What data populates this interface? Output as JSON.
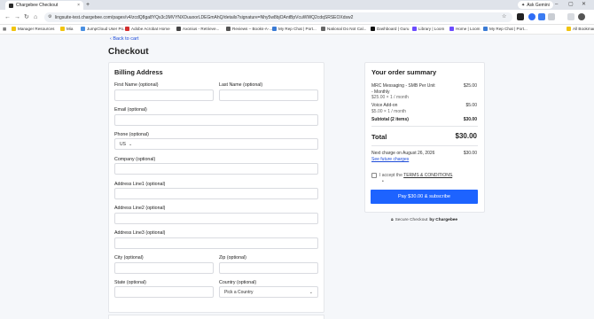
{
  "browser": {
    "tab_title": "Chargebee Checkout",
    "tab_close": "×",
    "new_tab": "+",
    "ask_gemini": "Ask Gemini",
    "url": "lingsuite-test.chargebee.com/pages/v4/zcdQ8ga8YQs3c3MVYNXDuuoorLDEGmAhQ/details?signature=Nhy5w8bjOAntBpVcuWWQ2cdqSRSEOXdsw2",
    "bookmarks": [
      {
        "label": "Manager Resources",
        "icon": "folder-icon"
      },
      {
        "label": "Mia",
        "icon": "folder-icon"
      },
      {
        "label": "JumpCloud User Po...",
        "icon": "cloud-icon"
      },
      {
        "label": "Adobe Acrobat Home",
        "icon": "acrobat-icon"
      },
      {
        "label": "Axonius - Retrieve...",
        "icon": "axonius-icon"
      },
      {
        "label": "Reviews – Books-A-...",
        "icon": "page-icon"
      },
      {
        "label": "My Rep Chat | Port...",
        "icon": "chat-icon"
      },
      {
        "label": "National Do Not Cal...",
        "icon": "phone-icon"
      },
      {
        "label": "Dashboard | Guru",
        "icon": "guru-icon"
      },
      {
        "label": "Library | Loom",
        "icon": "loom-icon"
      },
      {
        "label": "Home | Loom",
        "icon": "loom-icon"
      },
      {
        "label": "My Rep Chat | Port...",
        "icon": "chat-icon"
      },
      {
        "label": "All Bookmarks",
        "icon": "folder-icon"
      }
    ]
  },
  "page": {
    "back_link": "‹ Back to cart",
    "title": "Checkout"
  },
  "billing": {
    "title": "Billing Address",
    "first_name_label": "First Name (optional)",
    "last_name_label": "Last Name (optional)",
    "email_label": "Email (optional)",
    "phone_label": "Phone (optional)",
    "phone_country": "US",
    "company_label": "Company (optional)",
    "address1_label": "Address Line1 (optional)",
    "address2_label": "Address Line2 (optional)",
    "address3_label": "Address Line3 (optional)",
    "city_label": "City (optional)",
    "zip_label": "Zip (optional)",
    "state_label": "State (optional)",
    "country_label": "Country (optional)",
    "country_value": "Pick a Country"
  },
  "summary": {
    "title": "Your order summary",
    "items": [
      {
        "name": "MRC Messaging - SMB Per Unit",
        "name2": "- Monthly",
        "detail": "$25.00 × 1 / month",
        "amount": "$25.00"
      },
      {
        "name": "Voice Add-on",
        "detail": "$5.00 × 1 / month",
        "amount": "$5.00"
      }
    ],
    "subtotal_label": "Subtotal (2 items)",
    "subtotal_amount": "$30.00",
    "total_label": "Total",
    "total_amount": "$30.00",
    "next_charge_label": "Next charge on August 26, 2026",
    "next_charge_amount": "$30.00",
    "future_charges_link": "See future charges",
    "accept_prefix": "I accept the ",
    "terms_link": "TERMS & CONDITIONS",
    "accept_suffix": ".",
    "pay_button": "Pay $30.00 & subscribe",
    "secure_prefix": "Secure Checkout",
    "secure_by": "by Chargebee"
  },
  "colors": {
    "accent": "#1d63ff",
    "link": "#1c4bd9",
    "page_bg": "#f5f7fa"
  }
}
